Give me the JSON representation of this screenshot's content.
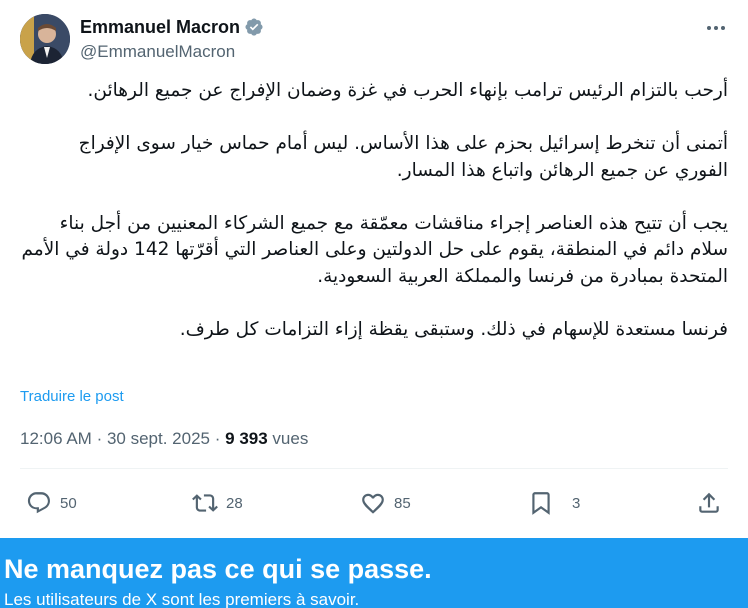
{
  "author": {
    "display_name": "Emmanuel Macron",
    "handle": "@EmmanuelMacron",
    "verified_icon": "verified-badge-icon"
  },
  "tweet": {
    "paragraphs": [
      "أرحب بالتزام الرئيس ترامب بإنهاء الحرب في غزة وضمان الإفراج عن جميع الرهائن.",
      "أتمنى أن تنخرط إسرائيل بحزم على هذا الأساس. ليس أمام حماس خيار سوى الإفراج الفوري عن جميع الرهائن واتباع هذا المسار.",
      "يجب أن تتيح هذه العناصر إجراء مناقشات معمّقة مع جميع الشركاء المعنيين من أجل بناء سلام دائم في المنطقة، يقوم على حل الدولتين وعلى العناصر التي أقرّتها 142 دولة في الأمم المتحدة بمبادرة من فرنسا والمملكة العربية السعودية.",
      "فرنسا مستعدة للإسهام في ذلك. وستبقى يقظة إزاء التزامات كل طرف."
    ],
    "translate_label": "Traduire le post",
    "time": "12:06 AM",
    "date": "30 sept. 2025",
    "separator": "·",
    "views_count": "9 393",
    "views_label": "vues"
  },
  "actions": {
    "replies": "50",
    "reposts": "28",
    "likes": "85",
    "bookmarks": "3"
  },
  "banner": {
    "title": "Ne manquez pas ce qui se passe.",
    "subtitle": "Les utilisateurs de X sont les premiers à savoir."
  },
  "colors": {
    "accent": "#1d9bf0",
    "text_primary": "#0f1419",
    "text_secondary": "#536471"
  }
}
